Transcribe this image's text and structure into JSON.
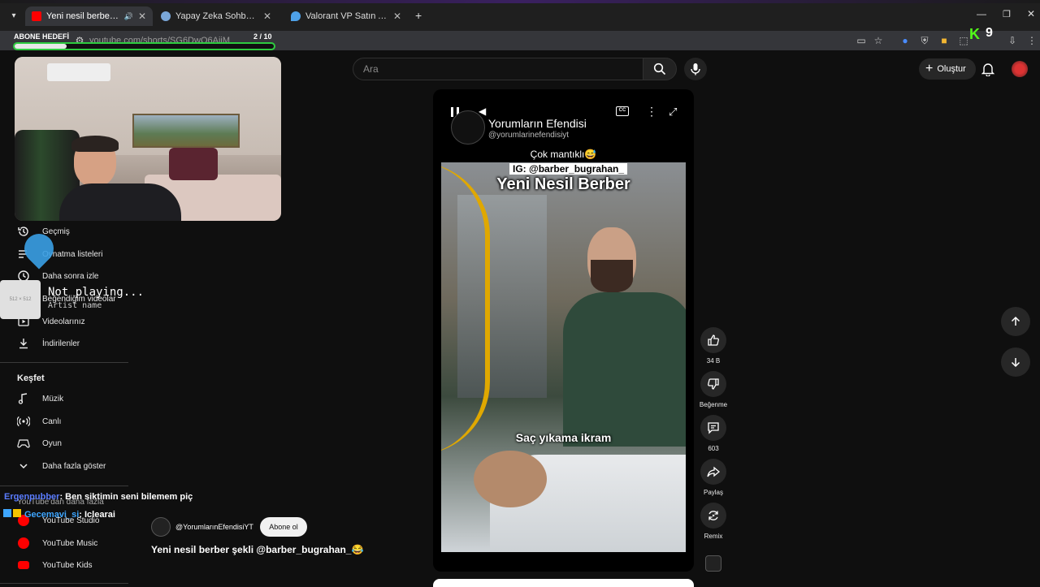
{
  "browser": {
    "tabs": [
      {
        "title": "Yeni nesil berber şekli @barber_bugrahan_",
        "active": true,
        "favicon_color": "#ff0000"
      },
      {
        "title": "Yapay Zeka Sohbet - MissXss AI",
        "active": false,
        "favicon_color": "#7aa7d8"
      },
      {
        "title": "Valorant VP Satın Al - En Ucuz VP",
        "active": false,
        "favicon_color": "#4ea1e8"
      }
    ],
    "url": "youtube.com/shorts/SG6DwO6AjiM",
    "extension_badge": "K",
    "extension_count": "9"
  },
  "overlay": {
    "goal_label": "ABONE HEDEFİ",
    "goal_progress": "2 / 10",
    "goal_fraction": 0.2,
    "music_status": "Not playing...",
    "music_artist": "Artist name",
    "music_art_label": "512 × 512",
    "chat": [
      {
        "user": "Ergenpubber",
        "message": ": Ben siktimin seni bilemem piç",
        "color": "#5a7cff"
      },
      {
        "user": "Gecemavi_si",
        "message": ": Iclearai",
        "color": "#3ea6ff"
      }
    ]
  },
  "header": {
    "search_placeholder": "Ara",
    "create_label": "Oluştur"
  },
  "sidebar": {
    "you_items": [
      {
        "label": "Geçmiş",
        "icon": "history-icon"
      },
      {
        "label": "Oynatma listeleri",
        "icon": "playlist-icon"
      },
      {
        "label": "Daha sonra izle",
        "icon": "clock-icon"
      },
      {
        "label": "Beğendiğim videolar",
        "icon": "thumb-up-icon"
      },
      {
        "label": "Videolarınız",
        "icon": "video-icon"
      },
      {
        "label": "İndirilenler",
        "icon": "download-icon"
      }
    ],
    "explore_heading": "Keşfet",
    "explore_items": [
      {
        "label": "Müzik",
        "icon": "music-icon"
      },
      {
        "label": "Canlı",
        "icon": "live-icon"
      },
      {
        "label": "Oyun",
        "icon": "game-icon"
      },
      {
        "label": "Daha fazla göster",
        "icon": "chevron-down-icon"
      }
    ],
    "more_heading": "YouTube'dan daha fazla",
    "more_items": [
      {
        "label": "YouTube Studio",
        "color": "#ff0000"
      },
      {
        "label": "YouTube Music",
        "color": "#ff0000"
      },
      {
        "label": "YouTube Kids",
        "color": "#ff0000"
      }
    ]
  },
  "short": {
    "channel_name": "Yorumların Efendisi",
    "channel_handle": "@yorumlarinefendisiyt",
    "caption_top": "Çok mantıklı😅",
    "ig_tag": "IG: @barber_bugrahan_",
    "video_title": "Yeni Nesil Berber",
    "video_subtitle": "Saç yıkama ikram",
    "owner_handle": "@YorumlarınEfendisiYT",
    "subscribe_label": "Abone ol",
    "description": "Yeni nesil berber şekli @barber_bugrahan_😂",
    "likes": "34 B",
    "dislike_label": "Beğenme",
    "comments": "603",
    "share_label": "Paylaş",
    "remix_label": "Remix"
  }
}
